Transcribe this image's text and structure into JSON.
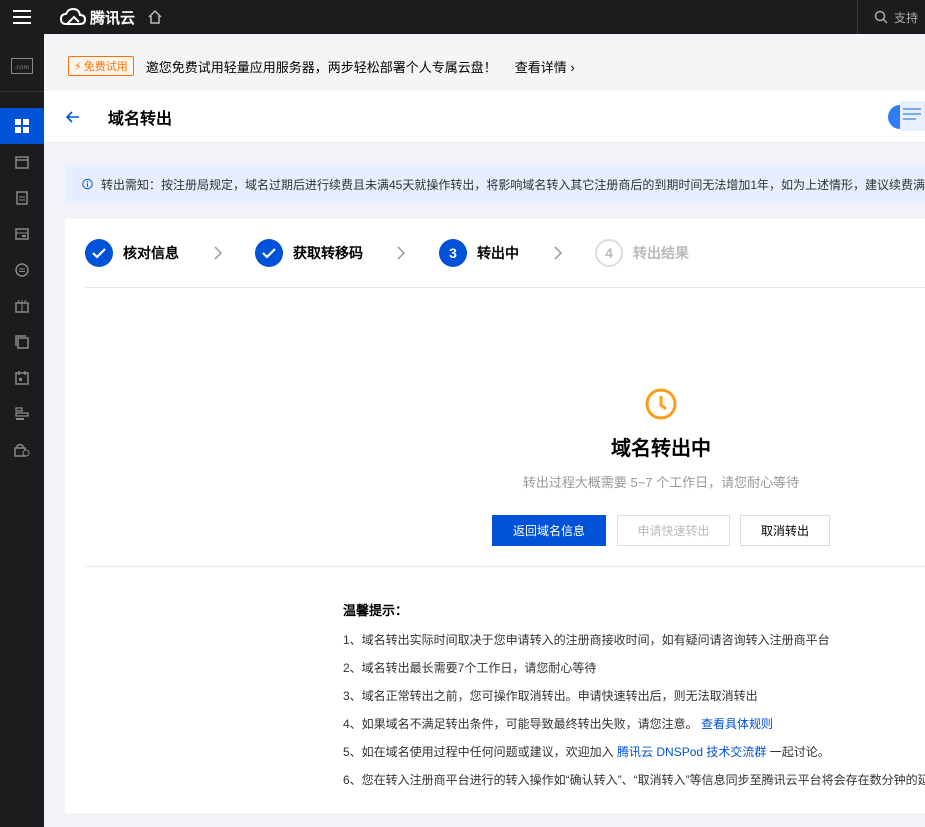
{
  "topbar": {
    "brand": "腾讯云",
    "search_placeholder": "支持"
  },
  "promo": {
    "badge": "免费试用",
    "text": "邀您免费试用轻量应用服务器，两步轻松部署个人专属云盘！",
    "link": "查看详情 ›"
  },
  "header": {
    "title": "域名转出"
  },
  "notice": {
    "text": "转出需知：按注册局规定，域名过期后进行续费且未满45天就操作转出，将影响域名转入其它注册商后的到期时间无法增加1年，如为上述情形，建议续费满"
  },
  "steps": [
    {
      "label": "核对信息",
      "state": "done"
    },
    {
      "label": "获取转移码",
      "state": "done"
    },
    {
      "number": "3",
      "label": "转出中",
      "state": "current"
    },
    {
      "number": "4",
      "label": "转出结果",
      "state": "pending"
    }
  ],
  "status": {
    "title": "域名转出中",
    "desc": "转出过程大概需要 5~7 个工作日，请您耐心等待"
  },
  "buttons": {
    "back": "返回域名信息",
    "fast": "申请快速转出",
    "cancel": "取消转出"
  },
  "tips": {
    "title": "温馨提示：",
    "items": [
      {
        "text": "1、域名转出实际时间取决于您申请转入的注册商接收时间，如有疑问请咨询转入注册商平台"
      },
      {
        "text": "2、域名转出最长需要7个工作日，请您耐心等待"
      },
      {
        "text": "3、域名正常转出之前，您可操作取消转出。申请快速转出后，则无法取消转出"
      },
      {
        "text": "4、如果域名不满足转出条件，可能导致最终转出失败，请您注意。",
        "link": "查看具体规则"
      },
      {
        "text": "5、如在域名使用过程中任何问题或建议，欢迎加入",
        "link": "腾讯云 DNSPod 技术交流群",
        "after": "一起讨论。"
      },
      {
        "text": "6、您在转入注册商平台进行的转入操作如“确认转入”、“取消转入”等信息同步至腾讯云平台将会存在数分钟的延"
      }
    ]
  },
  "colors": {
    "primary": "#0052d9",
    "warning": "#ff9c19",
    "dark": "#1c1c1f"
  }
}
